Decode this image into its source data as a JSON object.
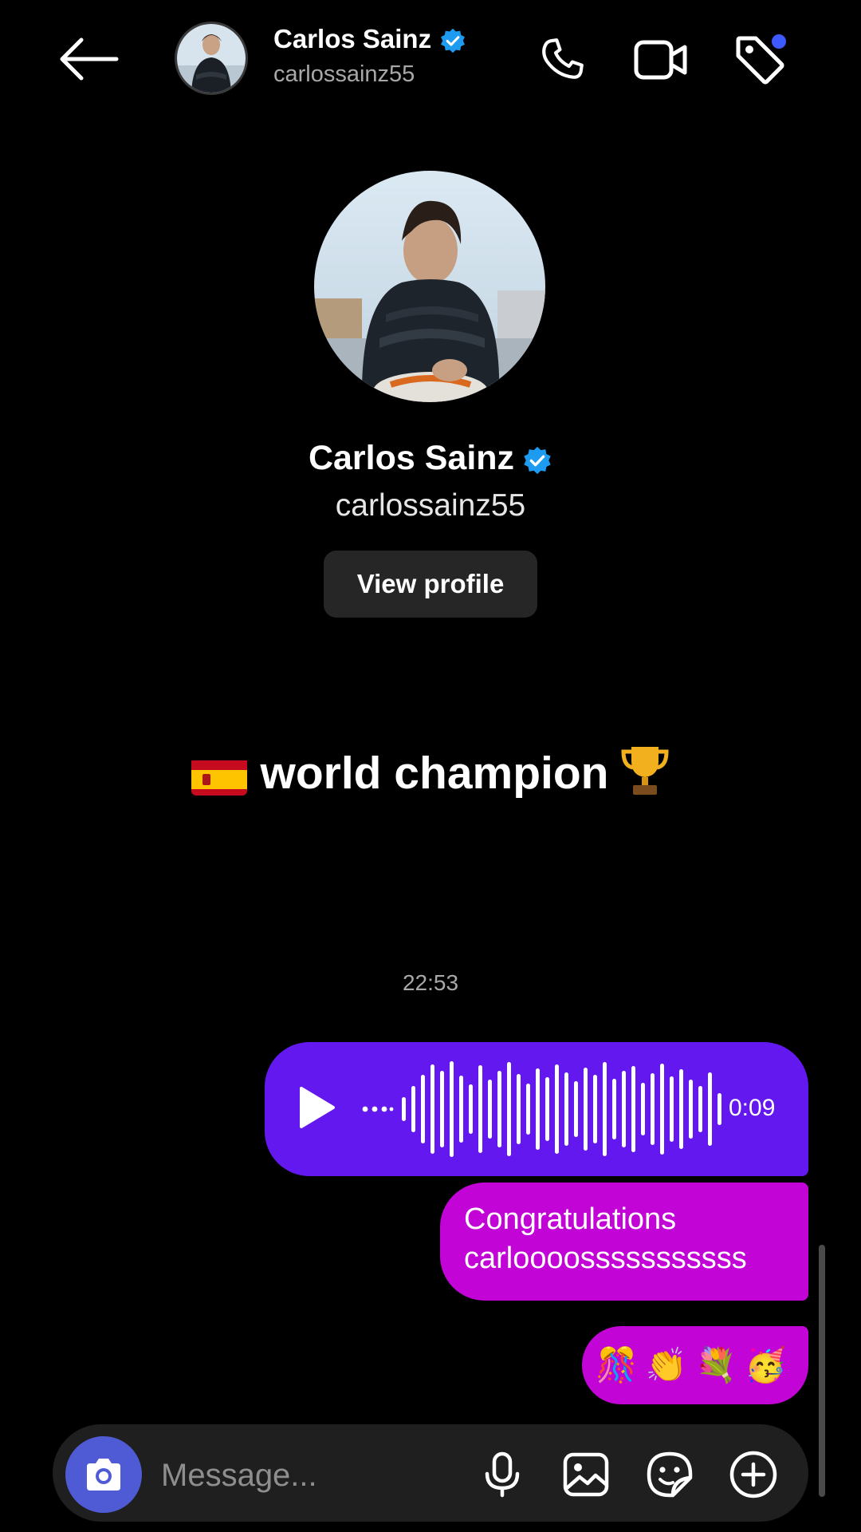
{
  "header": {
    "name": "Carlos Sainz",
    "username": "carlossainz55",
    "icons": [
      "back-arrow-icon",
      "phone-icon",
      "video-camera-icon",
      "tag-icon"
    ]
  },
  "profile": {
    "name": "Carlos Sainz",
    "username": "carlossainz55",
    "view_profile_label": "View profile"
  },
  "banner": {
    "flag": "🇪🇸",
    "text": "world champion",
    "trophy": "🏆"
  },
  "conversation": {
    "timestamp": "22:53",
    "messages": [
      {
        "type": "voice",
        "duration": "0:09"
      },
      {
        "type": "text",
        "line1": "Congratulations",
        "line2": "carloooosssssssssss"
      },
      {
        "type": "emoji",
        "text": "🎊👏💐🥳"
      }
    ]
  },
  "composer": {
    "placeholder": "Message...",
    "icons": [
      "camera-icon",
      "microphone-icon",
      "gallery-icon",
      "sticker-icon",
      "plus-icon"
    ]
  },
  "colors": {
    "background": "#000000",
    "voice_bubble": "#6418f0",
    "text_bubble": "#c304d6",
    "verified": "#1d9bf0",
    "camera_button": "#4f5bd5",
    "notification_dot": "#3d5afe"
  }
}
